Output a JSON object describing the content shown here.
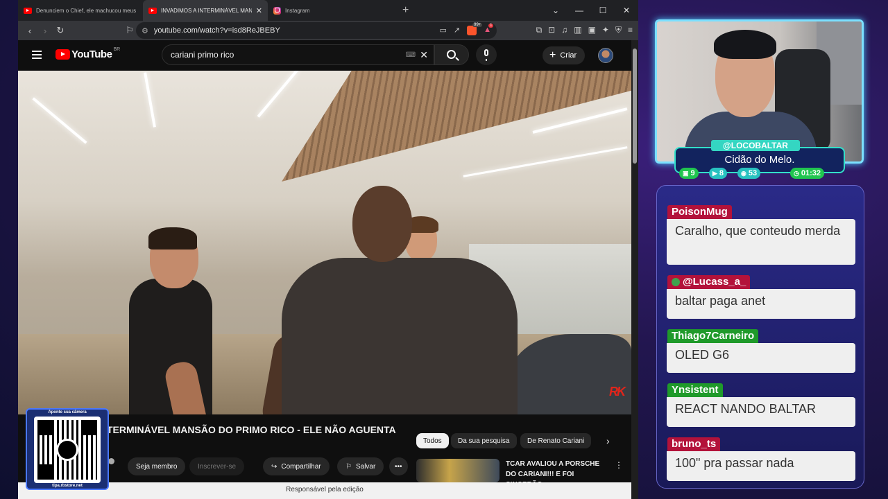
{
  "browser": {
    "tabs": [
      {
        "title": "Denunciem o Chief, ele machucou meus sentimentos",
        "icon": "youtube-icon"
      },
      {
        "title": "INVADIMOS A INTERMINÁVEL MANSÃO",
        "icon": "youtube-icon",
        "active": true
      },
      {
        "title": "Instagram",
        "icon": "instagram-icon"
      }
    ],
    "new_tab": "+",
    "url": "youtube.com/watch?v=isd8ReJBEBY",
    "extension_badge": "99+",
    "alert_badge": "1"
  },
  "youtube": {
    "logo_text": "YouTube",
    "country_code": "BR",
    "search_query": "cariani primo rico",
    "create_label": "Criar",
    "video_title": "TERMINÁVEL MANSÃO DO PRIMO RICO - ELE NÃO AGUENTA",
    "watermark": "RK",
    "actions": {
      "join": "Seja membro",
      "subscribe": "Inscrever-se",
      "share": "Compartilhar",
      "save": "Salvar"
    },
    "chips": [
      "Todos",
      "Da sua pesquisa",
      "De Renato Cariani"
    ],
    "recommended": {
      "title": "TCAR AVALIOU A PORSCHE DO CARIANI!!! E FOI SINCERÃO..."
    },
    "footer_notice": "Responsável pela edição"
  },
  "qr": {
    "top_text": "Aponte sua câmera",
    "bottom_text": "tipa.rbstore.net"
  },
  "stream": {
    "handle": "@LOCOBALTAR",
    "subtitle": "Cidão do Melo.",
    "stats": [
      {
        "icon": "chat-icon",
        "value": "9"
      },
      {
        "icon": "youtube-icon",
        "value": "8"
      },
      {
        "icon": "kick-icon",
        "value": "53"
      },
      {
        "icon": "clock-icon",
        "value": "01:32"
      }
    ]
  },
  "chat": [
    {
      "user": "PoisonMug",
      "text": "Caralho, que conteudo merda",
      "color": "#b3123a"
    },
    {
      "user": "@Lucass_a_",
      "text": "baltar paga anet",
      "color": "#b3123a"
    },
    {
      "user": "Thiago7Carneiro",
      "text": "OLED G6",
      "color": "#1f9a2a"
    },
    {
      "user": "Ynsistent",
      "text": "REACT NANDO BALTAR",
      "color": "#1f9a2a"
    },
    {
      "user": "bruno_ts",
      "text": "100\" pra passar nada",
      "color": "#b3123a"
    }
  ]
}
